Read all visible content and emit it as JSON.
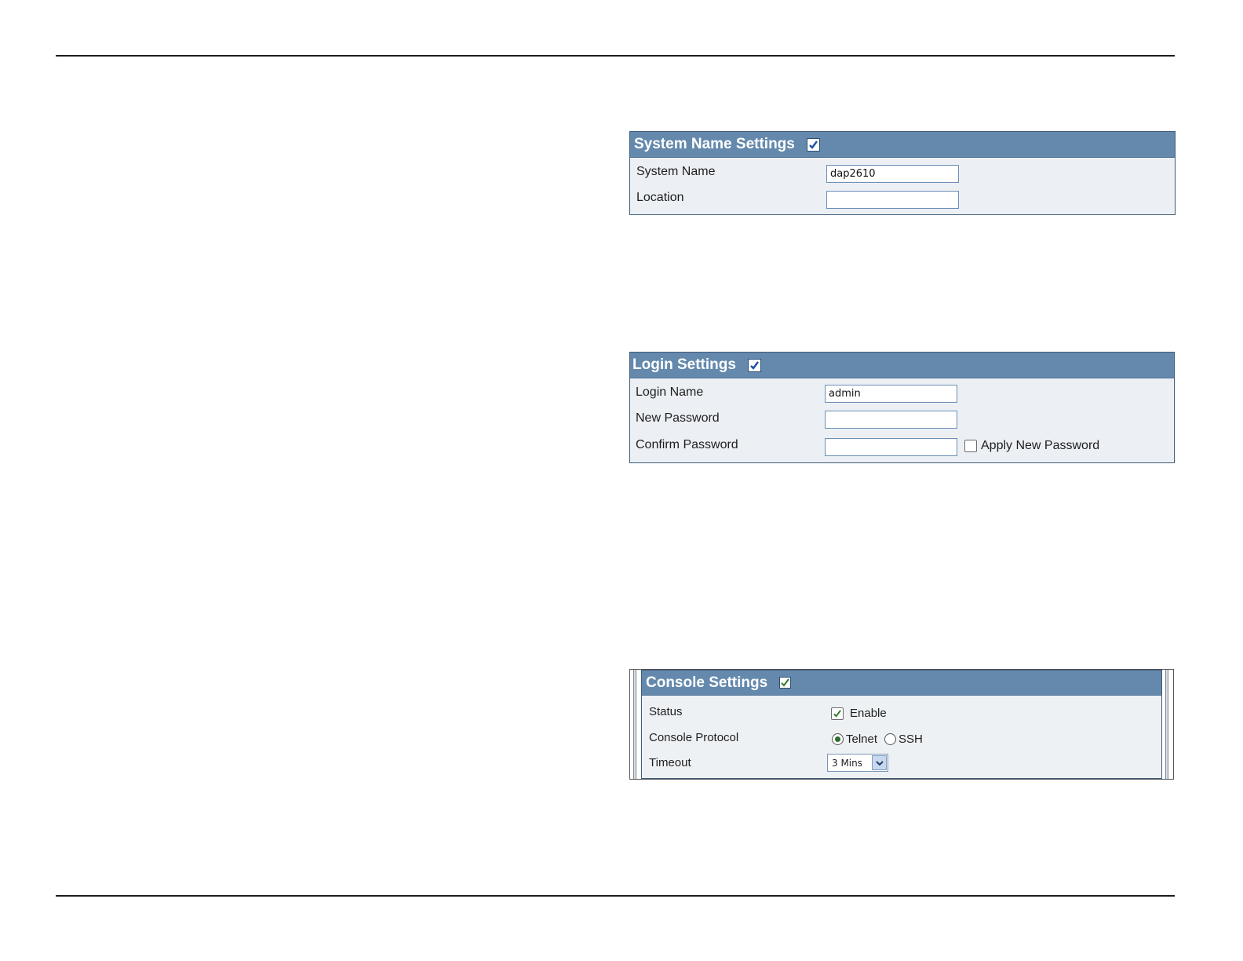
{
  "system_name_panel": {
    "title": "System Name Settings",
    "header_checked": true,
    "fields": {
      "system_name_label": "System Name",
      "system_name_value": "dap2610",
      "location_label": "Location",
      "location_value": ""
    }
  },
  "login_panel": {
    "title": "Login Settings",
    "header_checked": true,
    "fields": {
      "login_name_label": "Login Name",
      "login_name_value": "admin",
      "new_password_label": "New Password",
      "new_password_value": "",
      "confirm_password_label": "Confirm Password",
      "confirm_password_value": "",
      "apply_new_password_label": "Apply New Password",
      "apply_new_password_checked": false
    }
  },
  "console_panel": {
    "title": "Console Settings",
    "header_checked": true,
    "status_label": "Status",
    "enable_label": "Enable",
    "enable_checked": true,
    "protocol_label": "Console Protocol",
    "protocol_options": [
      "Telnet",
      "SSH"
    ],
    "protocol_selected": "Telnet",
    "timeout_label": "Timeout",
    "timeout_value": "3 Mins"
  },
  "colors": {
    "header_blue": "#6489ad",
    "panel_bg": "#ecf0f4",
    "border": "#3d5a78"
  }
}
